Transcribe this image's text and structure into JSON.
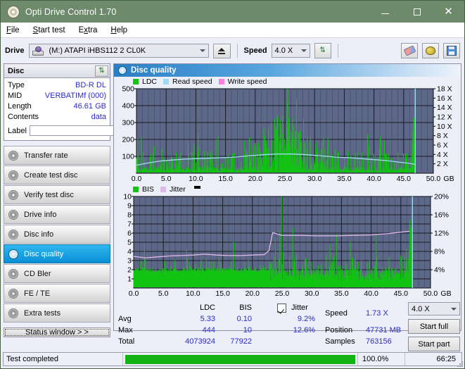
{
  "window": {
    "title": "Opti Drive Control 1.70",
    "icon": "disc-icon",
    "minimize": "–",
    "maximize": "□",
    "close": "✕"
  },
  "menu": {
    "items": [
      "File",
      "Start test",
      "Extra",
      "Help"
    ]
  },
  "drivebar": {
    "drive_label": "Drive",
    "drive_value": "(M:)   ATAPI iHBS112  2 CL0K",
    "eject": "eject-icon",
    "speed_label": "Speed",
    "speed_value": "4.0 X",
    "refresh": "refresh-icon",
    "eraser": "eraser-icon",
    "bulb": "bulb-icon",
    "save": "save-icon"
  },
  "disc": {
    "header": "Disc",
    "refresh": "refresh-icon",
    "rows": [
      {
        "key": "Type",
        "value": "BD-R DL"
      },
      {
        "key": "MID",
        "value": "VERBATIMf (000)"
      },
      {
        "key": "Length",
        "value": "46.61 GB"
      },
      {
        "key": "Contents",
        "value": "data"
      }
    ],
    "label_key": "Label",
    "label_value": "",
    "label_placeholder": ""
  },
  "nav": {
    "items": [
      {
        "label": "Transfer rate",
        "active": false
      },
      {
        "label": "Create test disc",
        "active": false
      },
      {
        "label": "Verify test disc",
        "active": false
      },
      {
        "label": "Drive info",
        "active": false
      },
      {
        "label": "Disc info",
        "active": false
      },
      {
        "label": "Disc quality",
        "active": true
      },
      {
        "label": "CD Bler",
        "active": false
      },
      {
        "label": "FE / TE",
        "active": false
      },
      {
        "label": "Extra tests",
        "active": false
      }
    ],
    "status_window": "Status window > >"
  },
  "content": {
    "title": "Disc quality"
  },
  "colors": {
    "ldc": "#13c413",
    "read_speed": "#9fdcf4",
    "write_speed": "#ff7fe0",
    "bis": "#13c413",
    "jitter": "#e0b8e8",
    "plot_bg": "#5d6787",
    "accent": "#2b2bc9"
  },
  "chart_data": [
    {
      "type": "line",
      "title": "Disc quality - LDC / Read speed",
      "xlabel": "GB",
      "ylabel": "LDC",
      "y2label": "X",
      "xlim": [
        0,
        50
      ],
      "ylim": [
        0,
        500
      ],
      "y2lim": [
        0,
        18
      ],
      "grid": true,
      "legend": [
        "LDC",
        "Read speed",
        "Write speed"
      ],
      "legend_position": "top-left",
      "xticks": [
        "0.0",
        "5.0",
        "10.0",
        "15.0",
        "20.0",
        "25.0",
        "30.0",
        "35.0",
        "40.0",
        "45.0",
        "50.0"
      ],
      "yticks": [
        100,
        200,
        300,
        400,
        500
      ],
      "y2ticks": [
        "2 X",
        "4 X",
        "6 X",
        "8 X",
        "10 X",
        "12 X",
        "14 X",
        "16 X",
        "18 X"
      ],
      "series": [
        {
          "name": "Read speed",
          "color": "#9fdcf4",
          "x": [
            0.0,
            2.0,
            4.0,
            6.0,
            8.0,
            10.0,
            12.0,
            14.0,
            16.0,
            18.0,
            20.0,
            22.0,
            24.0,
            26.0,
            28.0,
            30.0,
            32.0,
            34.0,
            36.0,
            38.0,
            40.0,
            42.0,
            44.0,
            46.0,
            46.9
          ],
          "y": [
            1.7,
            2.2,
            2.6,
            2.8,
            3.0,
            3.1,
            3.2,
            3.3,
            3.4,
            3.6,
            3.8,
            4.0,
            4.1,
            4.1,
            4.0,
            3.8,
            3.6,
            3.4,
            3.3,
            3.1,
            2.9,
            2.7,
            2.4,
            2.1,
            1.9
          ]
        },
        {
          "name": "LDC",
          "color": "#13c413",
          "description": "Dense green error spikes across whole disc; baseline ~10-40, frequent spikes 100-200, heaviest clustered between 20 and 30 GB reaching 300-450, isolated peak at ~46.8 GB reaching 330."
        }
      ]
    },
    {
      "type": "line",
      "title": "Disc quality - BIS / Jitter",
      "xlabel": "GB",
      "ylabel": "BIS",
      "y2label": "%",
      "xlim": [
        0,
        50
      ],
      "ylim": [
        0,
        10
      ],
      "y2lim": [
        0,
        20
      ],
      "grid": true,
      "legend": [
        "BIS",
        "Jitter"
      ],
      "legend_position": "top-left",
      "xticks": [
        "0.0",
        "5.0",
        "10.0",
        "15.0",
        "20.0",
        "25.0",
        "30.0",
        "35.0",
        "40.0",
        "45.0",
        "50.0"
      ],
      "yticks": [
        1,
        2,
        3,
        4,
        5,
        6,
        7,
        8,
        9,
        10
      ],
      "y2ticks": [
        "4%",
        "8%",
        "12%",
        "16%",
        "20%"
      ],
      "series": [
        {
          "name": "Jitter",
          "color": "#e0b8e8",
          "x": [
            0.0,
            2.0,
            4.0,
            6.0,
            8.0,
            10.0,
            12.0,
            14.0,
            16.0,
            18.0,
            20.0,
            22.0,
            22.8,
            23.4,
            25.0,
            28.0,
            31.0,
            34.0,
            37.0,
            40.0,
            43.0,
            45.0,
            46.5
          ],
          "y": [
            6.9,
            6.6,
            6.8,
            7.0,
            7.1,
            7.2,
            7.4,
            7.2,
            7.1,
            7.1,
            7.2,
            7.3,
            8.2,
            12.1,
            11.5,
            11.5,
            11.4,
            11.4,
            11.5,
            11.6,
            11.9,
            12.2,
            12.4
          ]
        },
        {
          "name": "BIS",
          "color": "#13c413",
          "description": "Dense green bars, solid fill to ~2 over first 22 GB with spikes to 3-5; after 23 GB baseline ~1-2 with many spikes 3-7 and isolated peaks to 8 and 10 near 24-26 GB."
        }
      ]
    }
  ],
  "stats": {
    "col_headers": [
      "LDC",
      "BIS"
    ],
    "rows": [
      {
        "label": "Avg",
        "ldc": "5.33",
        "bis": "0.10",
        "jitter": "9.2%"
      },
      {
        "label": "Max",
        "ldc": "444",
        "bis": "10",
        "jitter": "12.6%"
      },
      {
        "label": "Total",
        "ldc": "4073924",
        "bis": "77922",
        "jitter": ""
      }
    ],
    "jitter_label": "Jitter",
    "jitter_checked": true,
    "speed_label": "Speed",
    "speed_value": "1.73 X",
    "position_label": "Position",
    "position_value": "47731 MB",
    "samples_label": "Samples",
    "samples_value": "763156",
    "speed_select": "4.0 X",
    "start_full": "Start full",
    "start_part": "Start part"
  },
  "statusbar": {
    "text": "Test completed",
    "progress_pct": "100.0%",
    "progress_value": 100,
    "elapsed": "66:25"
  }
}
